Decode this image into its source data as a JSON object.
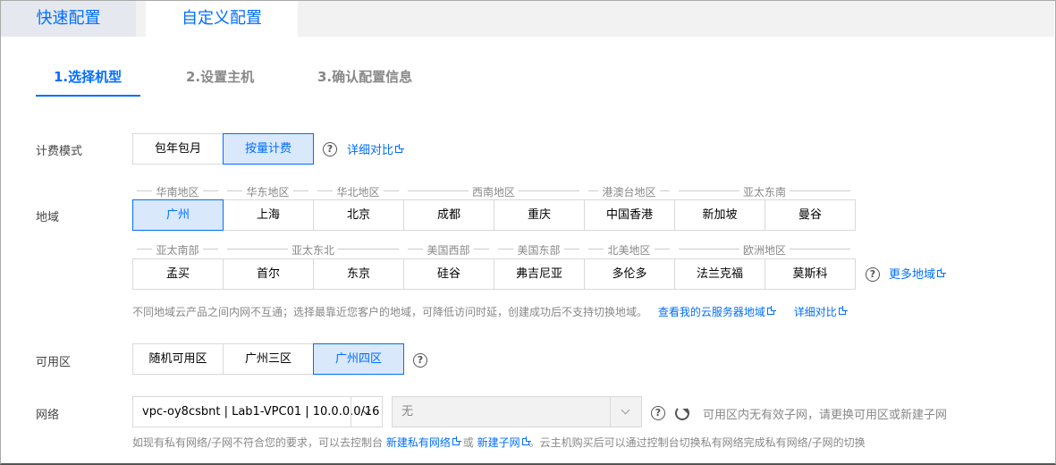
{
  "tabs": {
    "quick": "快速配置",
    "custom": "自定义配置"
  },
  "steps": [
    "1.选择机型",
    "2.设置主机",
    "3.确认配置信息"
  ],
  "billing": {
    "label": "计费模式",
    "options": [
      "包年包月",
      "按量计费"
    ],
    "selected": "按量计费",
    "link": "详细对比"
  },
  "region": {
    "label": "地域",
    "groups_row1": [
      "华南地区",
      "华东地区",
      "华北地区",
      "西南地区",
      "港澳台地区",
      "亚太东南"
    ],
    "cities_row1": [
      "广州",
      "上海",
      "北京",
      "成都",
      "重庆",
      "中国香港",
      "新加坡",
      "曼谷"
    ],
    "groups_row2": [
      "亚太南部",
      "亚太东北",
      "美国西部",
      "美国东部",
      "北美地区",
      "欧洲地区"
    ],
    "cities_row2": [
      "孟买",
      "首尔",
      "东京",
      "硅谷",
      "弗吉尼亚",
      "多伦多",
      "法兰克福",
      "莫斯科"
    ],
    "selected": "广州",
    "more_link": "更多地域",
    "note": "不同地域云产品之间内网不互通；选择最靠近您客户的地域，可降低访问时延，创建成功后不支持切换地域。",
    "note_link1": "查看我的云服务器地域",
    "note_link2": "详细对比"
  },
  "zone": {
    "label": "可用区",
    "options": [
      "随机可用区",
      "广州三区",
      "广州四区"
    ],
    "selected": "广州四区"
  },
  "network": {
    "label": "网络",
    "vpc_value": "vpc-oy8csbnt | Lab1-VPC01 | 10.0.0.0/16",
    "subnet_value": "无",
    "status": "可用区内无有效子网，请更换可用区或新建子网",
    "note_prefix": "如现有私有网络/子网不符合您的要求，可以去控制台",
    "note_link1": "新建私有网络",
    "note_or": "或",
    "note_link2": "新建子网",
    "note_suffix": "。云主机购买后可以通过控制台切换私有网络完成私有网络/子网的切换"
  }
}
